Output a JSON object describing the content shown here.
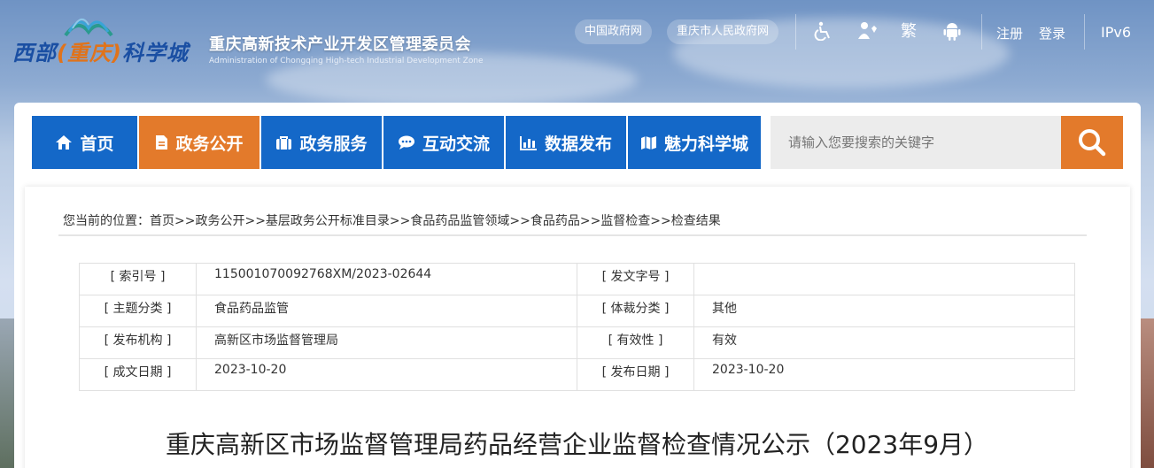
{
  "header": {
    "logo_parts": [
      "西部",
      "(重庆)",
      "科学城"
    ],
    "org_cn": "重庆高新技术产业开发区管理委员会",
    "org_en": "Administration of Chongqing High-tech Industrial Development Zone",
    "links": [
      "中国政府网",
      "重庆市人民政府网"
    ],
    "icons": [
      "accessibility-icon",
      "elder-care-icon",
      "traditional-chinese-icon",
      "android-icon"
    ],
    "traditional_label": "繁",
    "register": "注册",
    "login": "登录",
    "ipv6": "IPv6"
  },
  "nav": {
    "items": [
      {
        "label": "首页",
        "icon": "home-icon"
      },
      {
        "label": "政务公开",
        "icon": "document-icon",
        "active": true
      },
      {
        "label": "政务服务",
        "icon": "briefcase-icon"
      },
      {
        "label": "互动交流",
        "icon": "chat-icon"
      },
      {
        "label": "数据发布",
        "icon": "bar-chart-icon"
      },
      {
        "label": "魅力科学城",
        "icon": "map-icon"
      }
    ],
    "search_placeholder": "请输入您要搜索的关键字"
  },
  "breadcrumb": "您当前的位置：首页>>政务公开>>基层政务公开标准目录>>食品药品监管领域>>食品药品>>监督检查>>检查结果",
  "meta": {
    "rows": [
      [
        "[ 索引号 ]",
        "115001070092768XM/2023-02644",
        "[ 发文字号 ]",
        ""
      ],
      [
        "[ 主题分类 ]",
        "食品药品监管",
        "[ 体裁分类 ]",
        "其他"
      ],
      [
        "[ 发布机构 ]",
        "高新区市场监督管理局",
        "[ 有效性 ]",
        "有效"
      ],
      [
        "[ 成文日期 ]",
        "2023-10-20",
        "[ 发布日期 ]",
        "2023-10-20"
      ]
    ]
  },
  "article_title": "重庆高新区市场监督管理局药品经营企业监督检查情况公示（2023年9月）",
  "colors": {
    "nav_blue": "#1468c8",
    "accent_orange": "#e37a2b"
  }
}
